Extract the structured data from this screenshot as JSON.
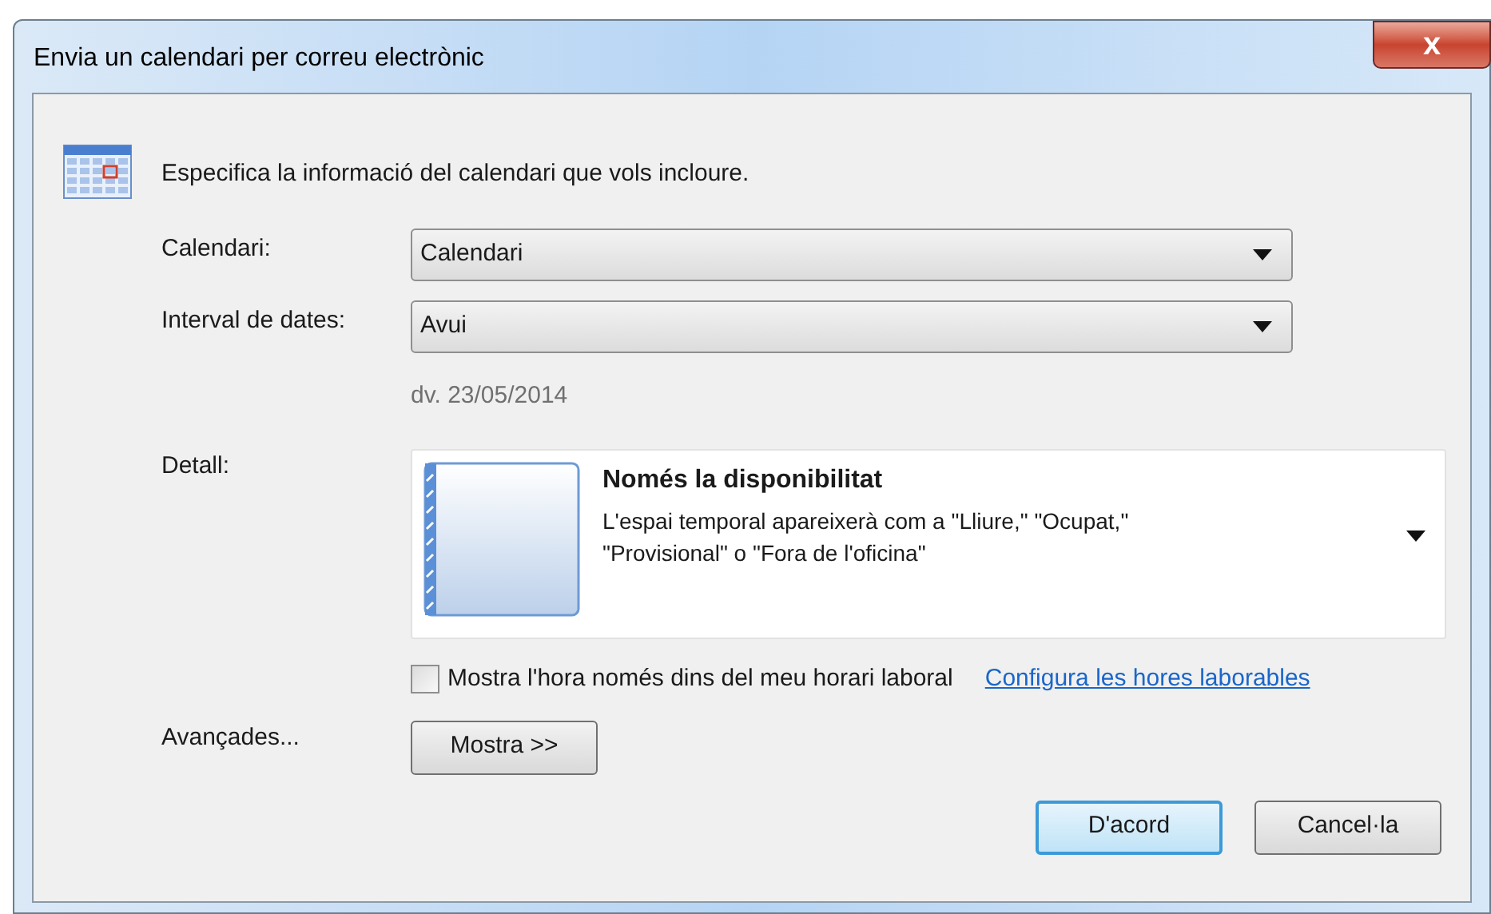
{
  "window": {
    "title": "Envia un calendari per correu electrònic",
    "close": "x"
  },
  "instruction": "Especifica la informació del calendari que vols incloure.",
  "fields": [
    {
      "label": "Calendari:",
      "value": "Calendari"
    },
    {
      "label": "Interval de dates:",
      "value": "Avui"
    }
  ],
  "date_note": "dv. 23/05/2014",
  "detail": {
    "label": "Detall:",
    "title": "Només la disponibilitat",
    "description": "L'espai temporal apareixerà com a \"Lliure,\" \"Ocupat,\" \"Provisional\" o \"Fora de l'oficina\""
  },
  "checkbox": {
    "label": "Mostra l'hora només dins del meu horari laboral",
    "checked": false
  },
  "link": "Configura les hores laborables",
  "advanced": {
    "label": "Avançades...",
    "button": "Mostra >>"
  },
  "buttons": [
    {
      "label": "D'acord",
      "default": true
    },
    {
      "label": "Cancel·la",
      "default": false
    }
  ]
}
